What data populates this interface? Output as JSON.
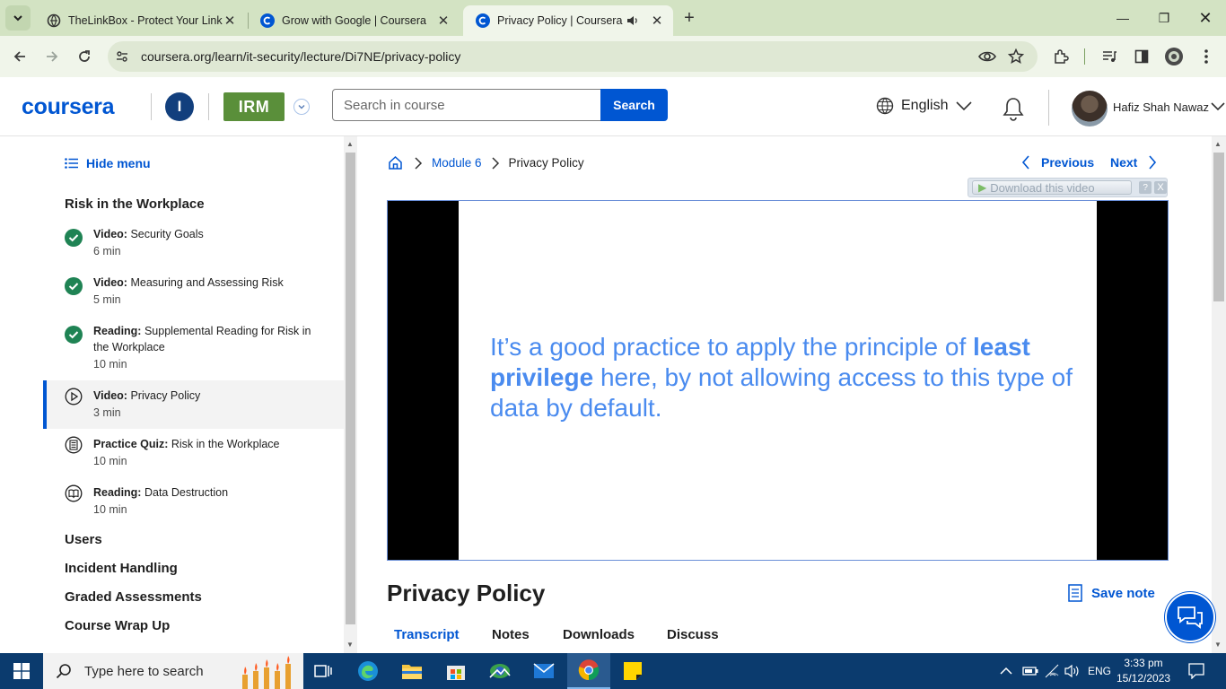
{
  "browser": {
    "tabs": [
      {
        "title": "TheLinkBox - Protect Your Link",
        "close": "✕",
        "favicon": "link-favicon"
      },
      {
        "title": "Grow with Google | Coursera",
        "close": "✕",
        "favicon": "coursera-favicon"
      },
      {
        "title": "Privacy Policy | Coursera",
        "close": "✕",
        "favicon": "coursera-favicon",
        "active": true
      }
    ],
    "new_tab": "+",
    "url": "coursera.org/learn/it-security/lecture/Di7NE/privacy-policy",
    "window_controls": {
      "minimize": "—",
      "restore": "❐",
      "close": "✕"
    }
  },
  "header": {
    "logo": "coursera",
    "university_initial": "I",
    "partner_logo": "IRM",
    "search_placeholder": "Search in course",
    "search_button": "Search",
    "language": "English",
    "user_name": "Hafiz Shah Nawaz"
  },
  "sidebar": {
    "hide_menu": "Hide menu",
    "module_title": "Risk in the Workplace",
    "items": [
      {
        "type": "Video:",
        "title": "Security Goals",
        "duration": "6 min",
        "status": "completed"
      },
      {
        "type": "Video:",
        "title": "Measuring and Assessing Risk",
        "duration": "5 min",
        "status": "completed"
      },
      {
        "type": "Reading:",
        "title": "Supplemental Reading for Risk in the Workplace",
        "duration": "10 min",
        "status": "completed"
      },
      {
        "type": "Video:",
        "title": "Privacy Policy",
        "duration": "3 min",
        "status": "current"
      },
      {
        "type": "Practice Quiz:",
        "title": "Risk in the Workplace",
        "duration": "10 min",
        "status": "quiz"
      },
      {
        "type": "Reading:",
        "title": "Data Destruction",
        "duration": "10 min",
        "status": "reading"
      }
    ],
    "sections": [
      "Users",
      "Incident Handling",
      "Graded Assessments",
      "Course Wrap Up"
    ]
  },
  "main": {
    "breadcrumb": {
      "module": "Module 6",
      "current": "Privacy Policy"
    },
    "previous": "Previous",
    "next": "Next",
    "download_bar": {
      "label": "Download this video",
      "help": "?",
      "close": "X"
    },
    "video_text_1": "It’s a good practice to apply the principle of ",
    "video_text_bold1": "least privilege",
    "video_text_2": " here, by not allowing access to this type of data by default.",
    "lecture_title": "Privacy Policy",
    "save_note": "Save note",
    "tabs": [
      "Transcript",
      "Notes",
      "Downloads",
      "Discuss"
    ]
  },
  "taskbar": {
    "search_placeholder": "Type here to search",
    "language": "ENG",
    "time": "3:33 pm",
    "date": "15/12/2023"
  },
  "colors": {
    "brand": "#0056d2",
    "chrome_tabbar": "#d3e3c3",
    "completed_green": "#1f8354",
    "video_text": "#4a8bef",
    "taskbar": "#0b3b6e"
  }
}
